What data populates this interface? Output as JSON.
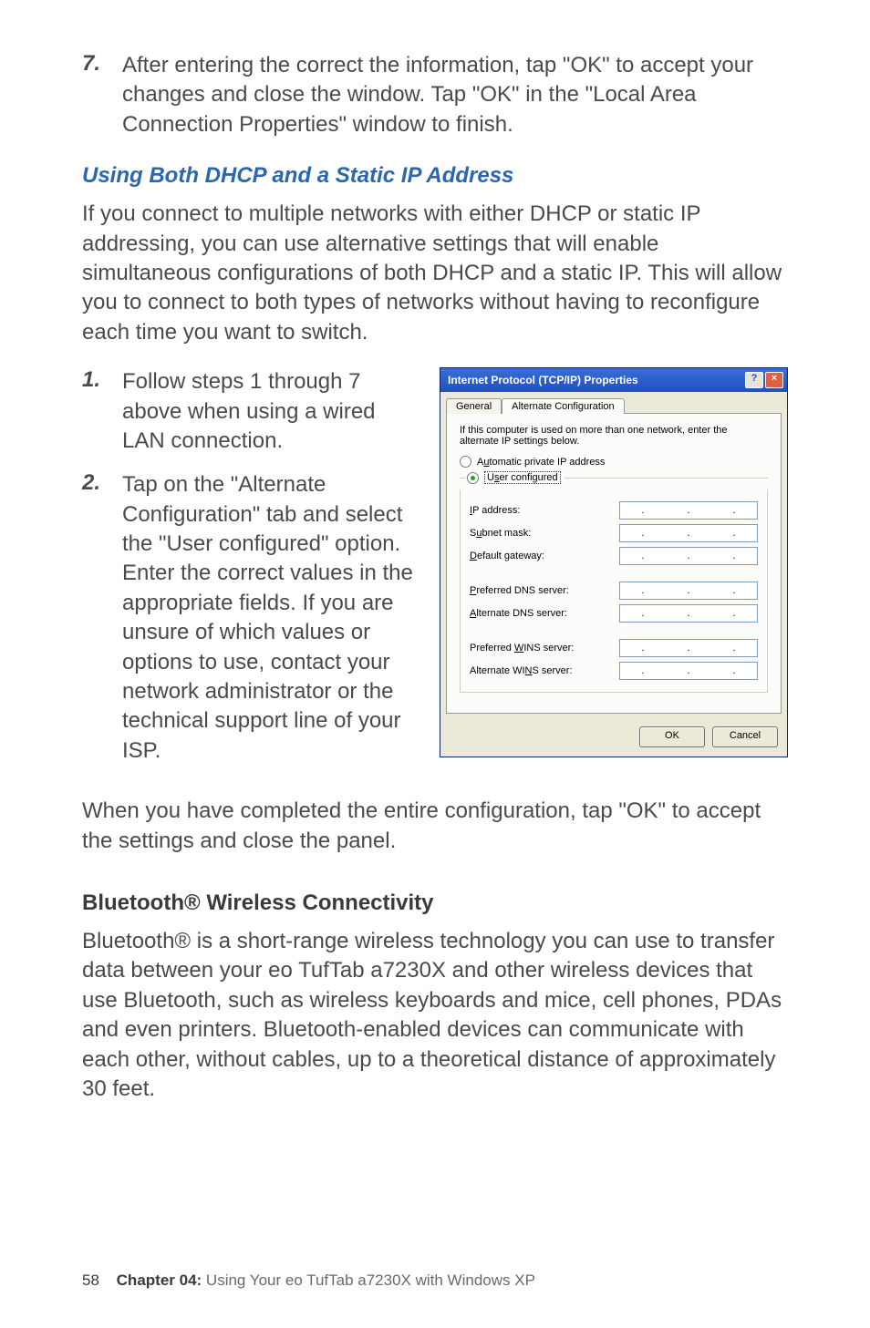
{
  "step7": {
    "num": "7.",
    "text": "After entering the correct the information, tap \"OK\" to accept your changes and close the window. Tap \"OK\" in the \"Local Area Connection Properties\" window to finish."
  },
  "heading_blue": "Using Both DHCP and a Static IP Address",
  "para_intro": "If you connect to multiple networks with either DHCP or static IP addressing, you can use alternative settings that will enable simultaneous configurations of both DHCP and a static IP. This will allow you to connect to both types of networks without having to reconfigure each time you want to switch.",
  "step1": {
    "num": "1.",
    "text": "Follow steps 1 through 7 above when using a wired LAN connection."
  },
  "step2": {
    "num": "2.",
    "text": "Tap on the \"Alternate Configuration\" tab and select the \"User configured\" option. Enter the correct values in the appropriate fields. If you are unsure of which values or options to use, contact your network administrator or the technical support line of your ISP."
  },
  "para_after": "When you have completed the entire configuration, tap \"OK\" to accept the settings and close the panel.",
  "heading_black": "Bluetooth® Wireless Connectivity",
  "para_bt": "Bluetooth® is a short-range wireless technology you can use to transfer data between your eo TufTab a7230X and other wireless devices that use Bluetooth, such as wireless keyboards and mice, cell phones, PDAs and even printers. Bluetooth-enabled devices can communicate with each other, without cables, up to a theoretical distance of approximately 30 feet.",
  "footer": {
    "page": "58",
    "chapter_label": "Chapter 04:",
    "chapter_text": " Using Your eo TufTab a7230X with Windows XP"
  },
  "dialog": {
    "title": "Internet Protocol (TCP/IP) Properties",
    "help_btn": "?",
    "close_btn": "×",
    "tabs": {
      "general": "General",
      "alt": "Alternate Configuration"
    },
    "desc": "If this computer is used on more than one network, enter the alternate IP settings below.",
    "radio_auto": "Automatic private IP address",
    "radio_user": "User configured",
    "labels": {
      "ip": "IP address:",
      "subnet": "Subnet mask:",
      "gateway": "Default gateway:",
      "pdns": "Preferred DNS server:",
      "adns": "Alternate DNS server:",
      "pwins": "Preferred WINS server:",
      "awins": "Alternate WINS server:"
    },
    "ok": "OK",
    "cancel": "Cancel"
  }
}
